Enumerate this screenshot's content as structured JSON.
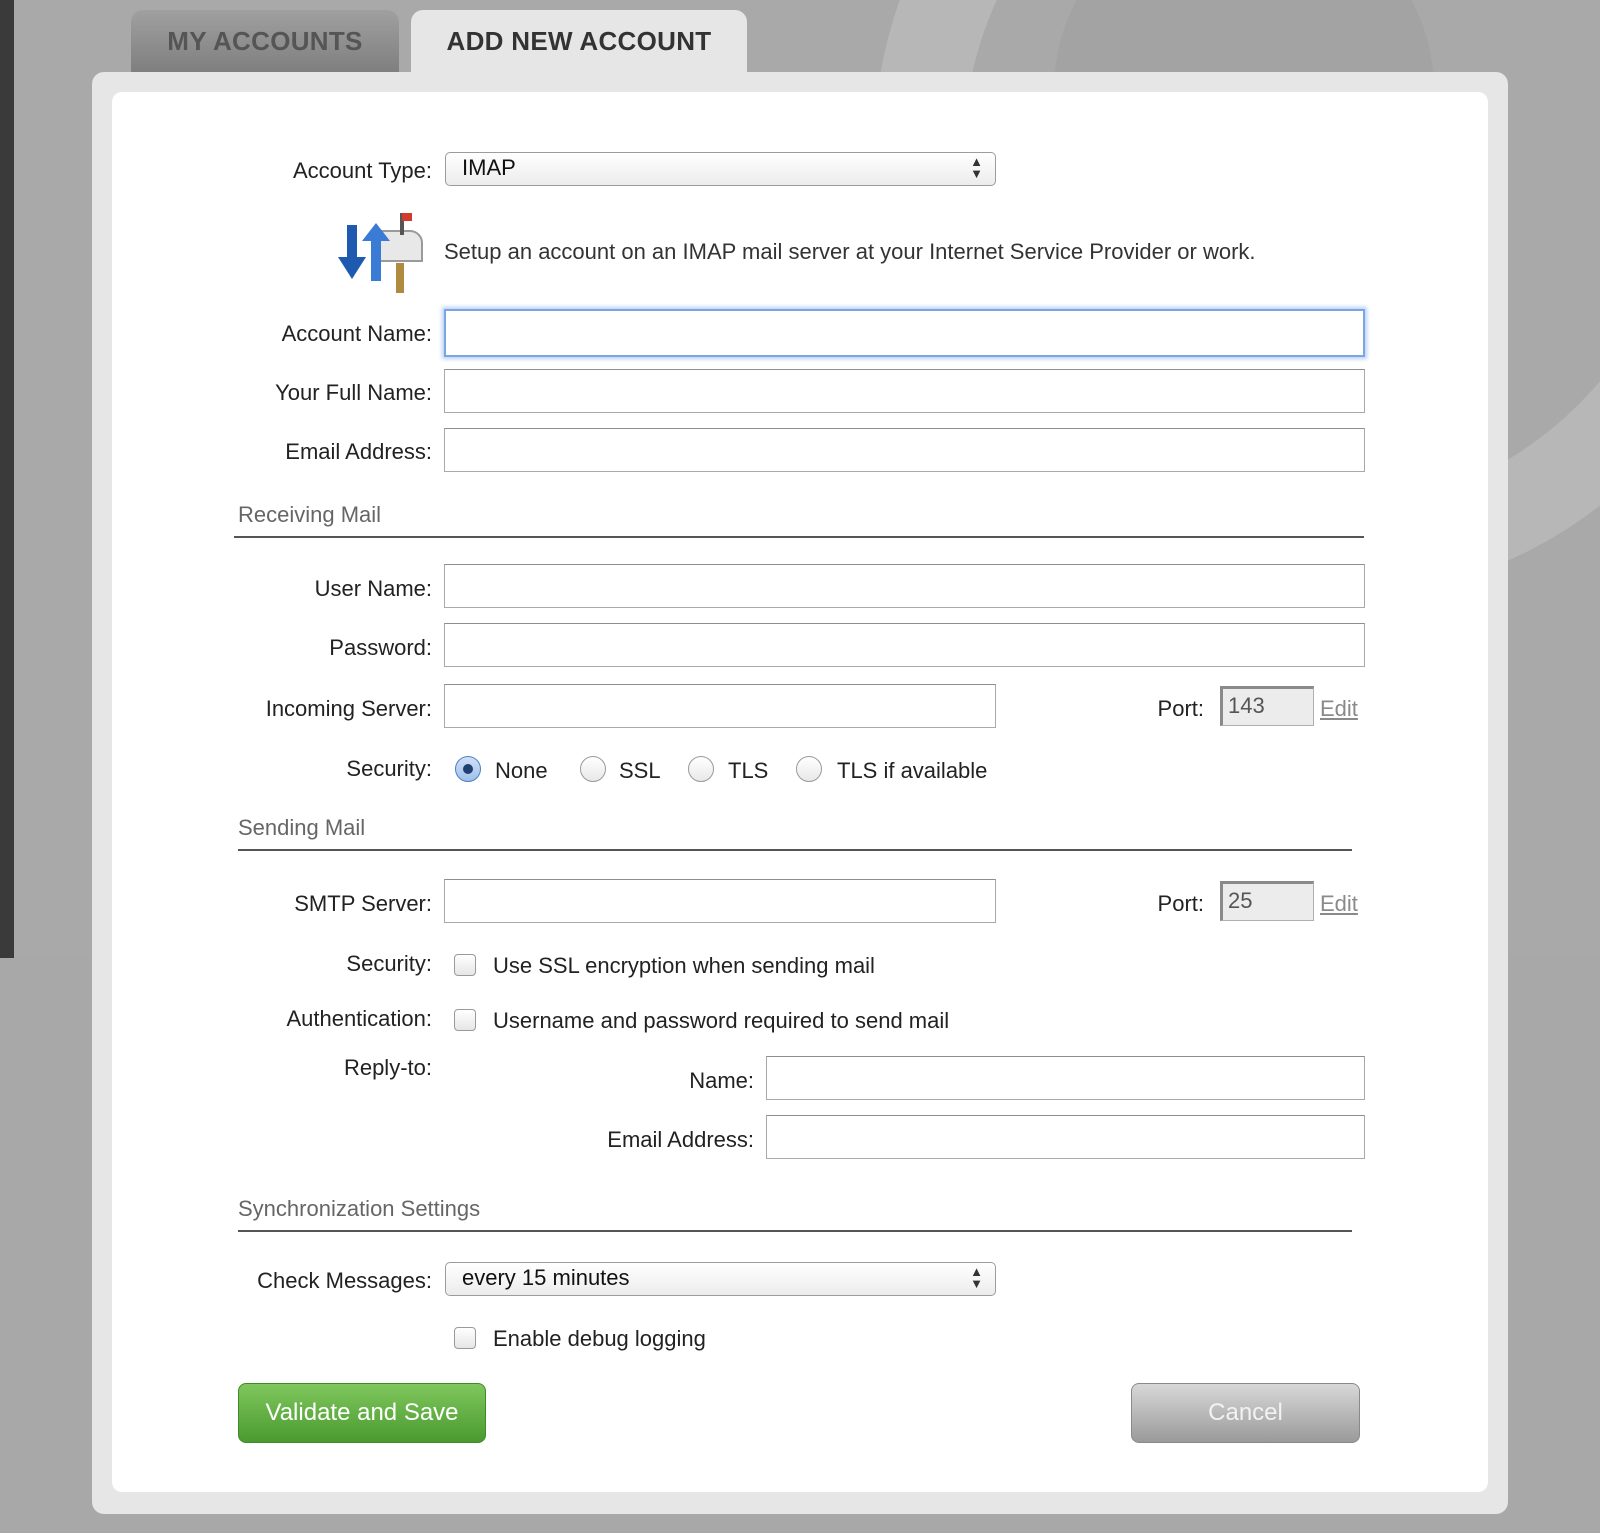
{
  "tabs": {
    "my_accounts": "MY ACCOUNTS",
    "add_new_account": "ADD NEW ACCOUNT"
  },
  "form": {
    "account_type_label": "Account Type:",
    "account_type_value": "IMAP",
    "description": "Setup an account on an IMAP mail server at your Internet Service Provider or work.",
    "account_name_label": "Account Name:",
    "full_name_label": "Your Full Name:",
    "email_label": "Email Address:"
  },
  "receiving": {
    "heading": "Receiving Mail",
    "user_name_label": "User Name:",
    "password_label": "Password:",
    "incoming_server_label": "Incoming Server:",
    "port_label": "Port:",
    "port_value": "143",
    "edit_label": "Edit",
    "security_label": "Security:",
    "security_options": [
      "None",
      "SSL",
      "TLS",
      "TLS if available"
    ],
    "security_selected": "None"
  },
  "sending": {
    "heading": "Sending Mail",
    "smtp_label": "SMTP Server:",
    "port_label": "Port:",
    "port_value": "25",
    "edit_label": "Edit",
    "security_label": "Security:",
    "ssl_checkbox_label": "Use SSL encryption when sending mail",
    "auth_label": "Authentication:",
    "auth_checkbox_label": "Username and password required to send mail",
    "reply_to_label": "Reply-to:",
    "reply_name_label": "Name:",
    "reply_email_label": "Email Address:"
  },
  "sync": {
    "heading": "Synchronization Settings",
    "check_messages_label": "Check Messages:",
    "check_messages_value": "every 15 minutes",
    "debug_label": "Enable debug logging"
  },
  "buttons": {
    "validate_save": "Validate and Save",
    "cancel": "Cancel"
  },
  "colors": {
    "save_green": "#5aaa3a",
    "focus_blue": "#7aa7e3",
    "panel_bg": "#e6e6e6"
  }
}
